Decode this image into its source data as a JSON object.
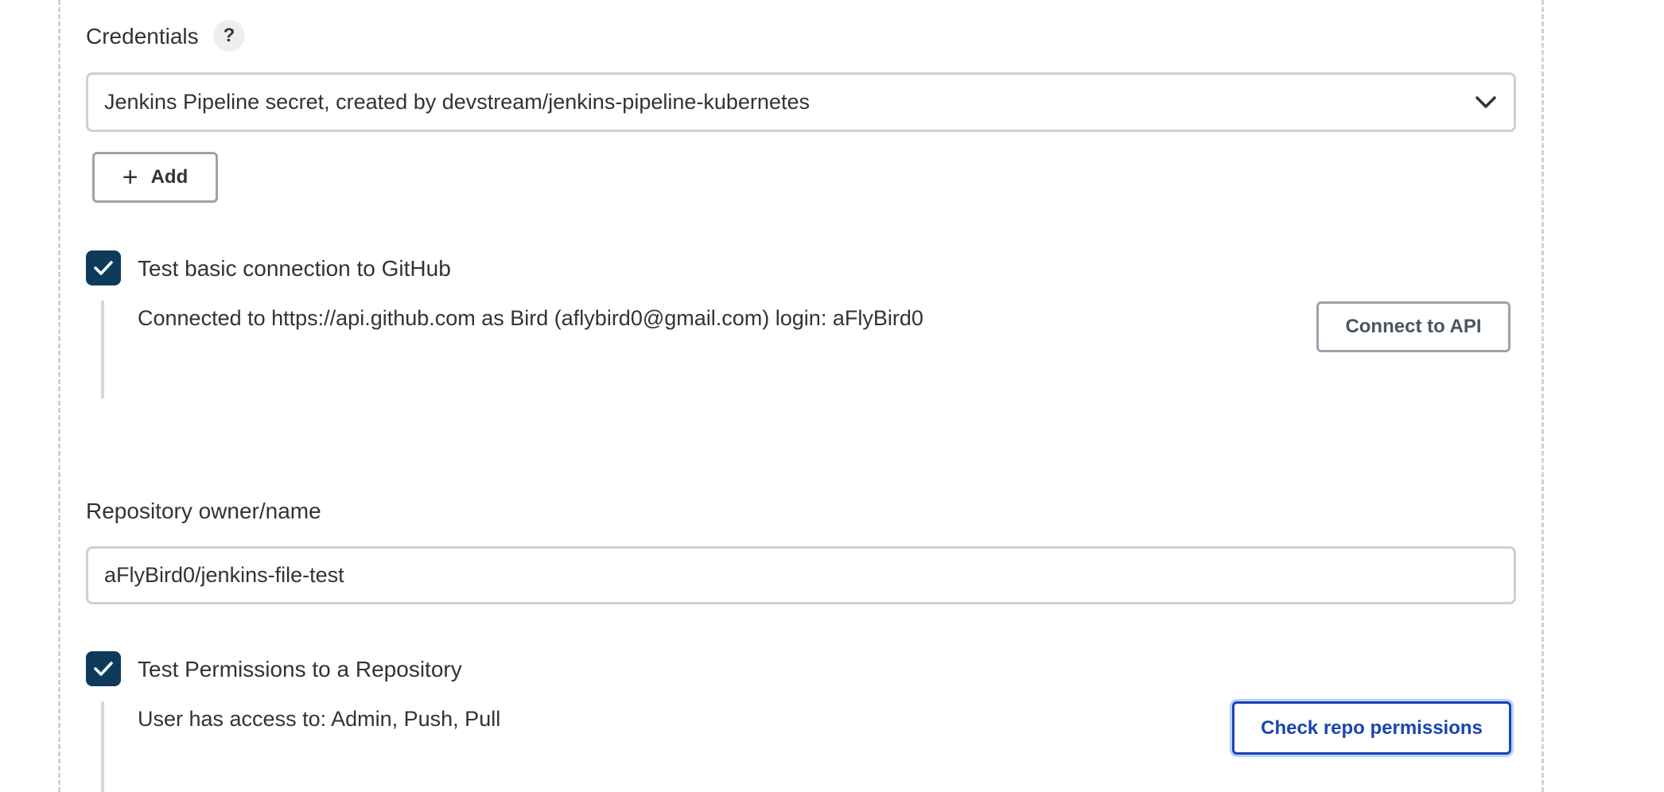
{
  "credentials": {
    "label": "Credentials",
    "help": "?",
    "selected": "Jenkins Pipeline secret, created by devstream/jenkins-pipeline-kubernetes",
    "add_label": "Add"
  },
  "github_test": {
    "checkbox_label": "Test basic connection to GitHub",
    "checked": true,
    "result": "Connected to https://api.github.com as Bird (aflybird0@gmail.com) login: aFlyBird0",
    "button_label": "Connect to API"
  },
  "repository": {
    "label": "Repository owner/name",
    "value": "aFlyBird0/jenkins-file-test"
  },
  "permissions_test": {
    "checkbox_label": "Test Permissions to a Repository",
    "checked": true,
    "result": "User has access to: Admin, Push, Pull",
    "button_label": "Check repo permissions"
  },
  "colors": {
    "checkbox": "#0e3b5c",
    "primary_button": "#1a45b0",
    "border": "#c9d0d6"
  }
}
